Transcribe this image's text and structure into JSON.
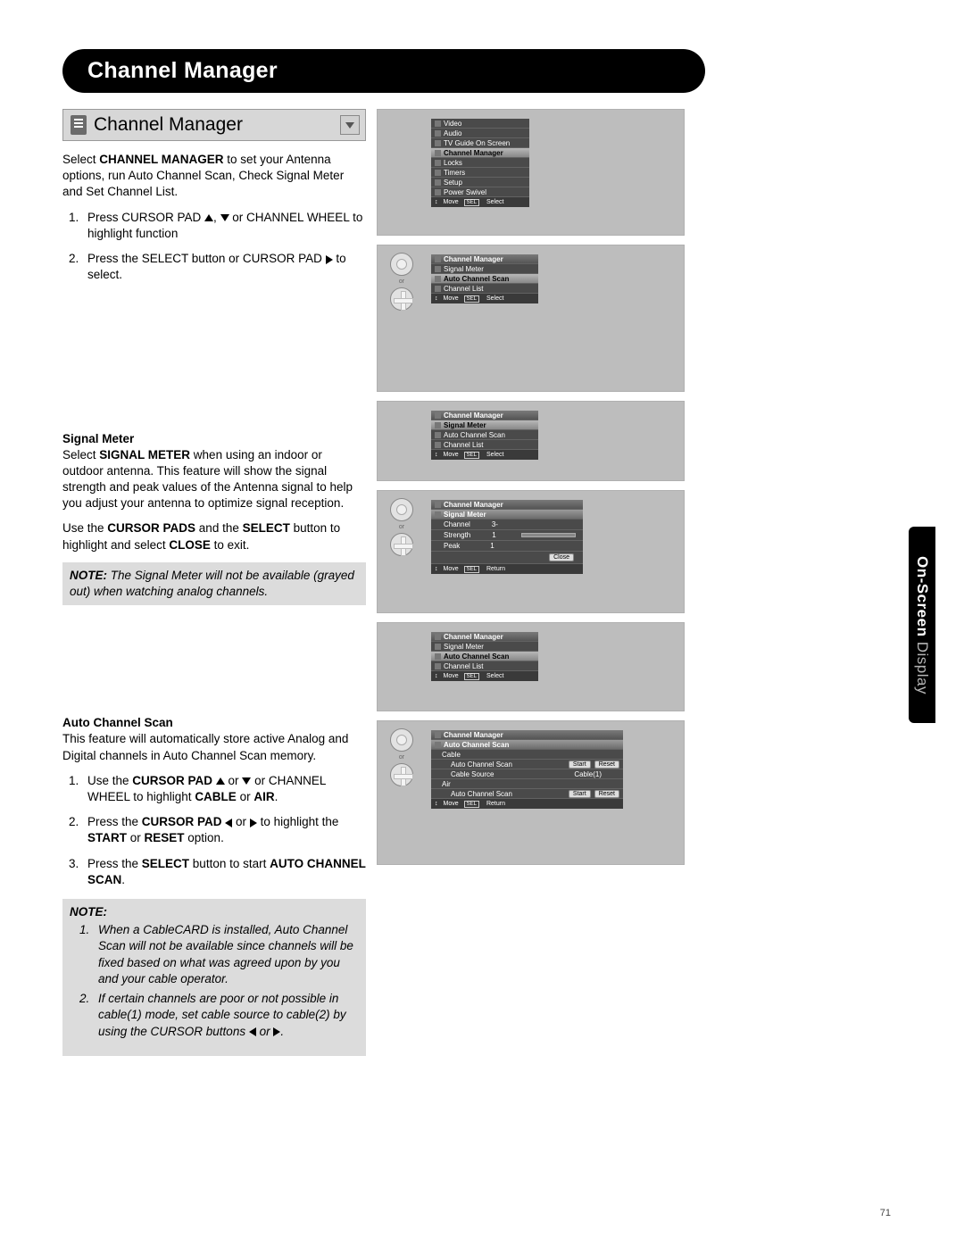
{
  "page_number": "71",
  "side_tab_bold": "On-Screen",
  "side_tab_light": " Display",
  "header": "Channel Manager",
  "section_title": "Channel Manager",
  "intro_p1_a": "Select ",
  "intro_p1_b": "CHANNEL MANAGER",
  "intro_p1_c": " to set your Antenna options, run Auto Channel Scan, Check Signal Meter and Set Channel List.",
  "step1_a": "Press CURSOR PAD ",
  "step1_b": ", ",
  "step1_c": " or CHANNEL WHEEL to highlight function",
  "step2_a": "Press the SELECT button or CURSOR PAD ",
  "step2_b": " to select.",
  "signal_meter_h": "Signal Meter",
  "sm_p1_a": "Select ",
  "sm_p1_b": "SIGNAL METER",
  "sm_p1_c": " when using an indoor or outdoor antenna. This feature will show the signal strength and peak values of the Antenna signal to help you adjust your antenna to optimize signal reception.",
  "sm_p2_a": "Use the ",
  "sm_p2_b": "CURSOR PADS",
  "sm_p2_c": " and the ",
  "sm_p2_d": "SELECT",
  "sm_p2_e": " button to highlight and select ",
  "sm_p2_f": "CLOSE",
  "sm_p2_g": " to exit.",
  "note1_label": "NOTE:",
  "note1_text": "  The Signal Meter will not be available (grayed out) when watching analog channels.",
  "auto_scan_h": "Auto Channel Scan",
  "as_p1": "This feature will automatically store active Analog and Digital channels in Auto Channel Scan memory.",
  "as_s1_a": "Use the ",
  "as_s1_b": "CURSOR PAD ",
  "as_s1_c": " or ",
  "as_s1_d": " or CHANNEL WHEEL to highlight ",
  "as_s1_e": "CABLE",
  "as_s1_f": " or ",
  "as_s1_g": "AIR",
  "as_s1_h": ".",
  "as_s2_a": "Press the ",
  "as_s2_b": "CURSOR PAD ",
  "as_s2_c": " or ",
  "as_s2_d": " to highlight the ",
  "as_s2_e": "START",
  "as_s2_f": " or ",
  "as_s2_g": "RESET",
  "as_s2_h": " option.",
  "as_s3_a": "Press the ",
  "as_s3_b": "SELECT",
  "as_s3_c": " button to start ",
  "as_s3_d": "AUTO CHANNEL SCAN",
  "as_s3_e": ".",
  "note2_label": "NOTE:",
  "note2_1": "When a CableCARD is installed, Auto Channel Scan will not be available since channels will be fixed based on what was agreed upon by you and your cable operator.",
  "note2_2a": "If certain channels are poor or not possible in cable(1) mode, set cable source to cable(2) by using the CURSOR buttons ",
  "note2_2b": " or ",
  "note2_2c": ".",
  "screens": {
    "s1": {
      "items": [
        "Video",
        "Audio",
        "TV Guide On Screen",
        "Channel Manager",
        "Locks",
        "Timers",
        "Setup",
        "Power Swivel"
      ],
      "highlight": "Channel Manager",
      "footer_move": "Move",
      "footer_sel": "SEL",
      "footer_action": "Select"
    },
    "s2": {
      "header": "Channel Manager",
      "items": [
        "Signal Meter",
        "Auto Channel Scan",
        "Channel List"
      ],
      "highlight": "Auto Channel Scan",
      "footer_move": "Move",
      "footer_sel": "SEL",
      "footer_action": "Select",
      "or": "or"
    },
    "s3": {
      "header": "Channel Manager",
      "items": [
        "Signal Meter",
        "Auto Channel Scan",
        "Channel List"
      ],
      "highlight": "Signal Meter",
      "footer_move": "Move",
      "footer_sel": "SEL",
      "footer_action": "Select"
    },
    "s4": {
      "header": "Channel Manager",
      "sub": "Signal Meter",
      "rows": [
        [
          "Channel",
          "3-"
        ],
        [
          "Strength",
          "1"
        ],
        [
          "Peak",
          "1"
        ]
      ],
      "close": "Close",
      "footer_move": "Move",
      "footer_sel": "SEL",
      "footer_action": "Return",
      "or": "or"
    },
    "s5": {
      "header": "Channel Manager",
      "items": [
        "Signal Meter",
        "Auto Channel Scan",
        "Channel List"
      ],
      "highlight": "Auto Channel Scan",
      "footer_move": "Move",
      "footer_sel": "SEL",
      "footer_action": "Select"
    },
    "s6": {
      "header": "Channel Manager",
      "sub": "Auto Channel Scan",
      "cable": "Cable",
      "c_row1_l": "Auto Channel Scan",
      "c_row2_l": "Cable Source",
      "c_row2_v": "Cable(1)",
      "air": "Air",
      "a_row1_l": "Auto Channel Scan",
      "start": "Start",
      "reset": "Reset",
      "footer_move": "Move",
      "footer_sel": "SEL",
      "footer_action": "Return",
      "or": "or"
    }
  }
}
